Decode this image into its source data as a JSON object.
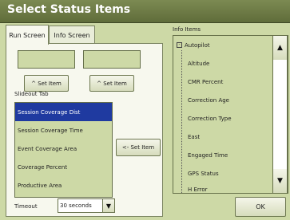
{
  "window": {
    "title": "Select Status Items",
    "corner_text": ""
  },
  "tabs": [
    {
      "label": "Run Screen",
      "active": true
    },
    {
      "label": "Info Screen",
      "active": false
    }
  ],
  "run_screen": {
    "set_item_left": "^ Set Item",
    "set_item_right": "^ Set Item",
    "slideout_label": "Slideout Tab",
    "slideout_items": [
      "Session Coverage Dist",
      "Session Coverage Time",
      "Event Coverage Area",
      "Coverage Percent",
      "Productive Area"
    ],
    "selected_index": 0,
    "set_item_from_list": "<- Set Item",
    "timeout_label": "Timeout",
    "timeout_value": "30 seconds"
  },
  "info_items": {
    "label": "Info Items",
    "group": "Autopilot",
    "items": [
      "Altitude",
      "CMR Percent",
      "Correction Age",
      "Correction Type",
      "East",
      "Engaged Time",
      "GPS Status",
      "H Error"
    ]
  },
  "ok_label": "OK",
  "colors": {
    "accent": "#1f3aa0",
    "panel": "#cdd9a6",
    "title_bar": "#6b7a45"
  },
  "icons": {
    "expand": "minus-box-icon",
    "up": "up-arrow-icon",
    "down": "down-arrow-icon"
  }
}
